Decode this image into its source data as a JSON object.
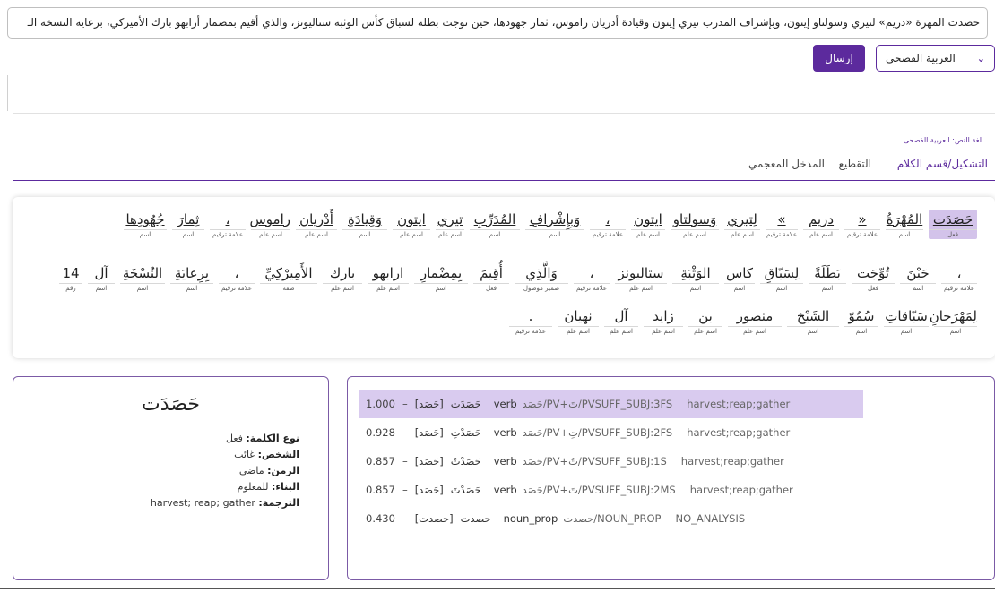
{
  "input_text": "حصدت المهرة «دريم» لتيري وسولتاو إيتون، وبإشراف المدرب تيري إيتون وقيادة أدريان راموس، ثمار جهودها، حين توجت بطلة لسباق كأس الوثبة ستاليونز، والذي أقيم بمضمار أرابهو بارك الأميركي، برعاية النسخة الـ",
  "dialect_select": {
    "value": "العربية الفصحى",
    "chevron": "⌄"
  },
  "submit_label": "إرسال",
  "lang_label": "لغة النص: العربية الفصحى",
  "tabs": [
    "التشكيل/قسم الكلام",
    "التقطيع",
    "المدخل المعجمي"
  ],
  "words": [
    {
      "w": "حَصَدَت",
      "t": "فعل"
    },
    {
      "w": "المُهْرَةُ",
      "t": "اسم"
    },
    {
      "w": "«",
      "t": "علامة ترقيم"
    },
    {
      "w": "دريم",
      "t": "اسم علم"
    },
    {
      "w": "»",
      "t": "علامة ترقيم"
    },
    {
      "w": "لِتيري",
      "t": "اسم علم"
    },
    {
      "w": "وَسولتاو",
      "t": "اسم علم"
    },
    {
      "w": "ايتون",
      "t": "اسم علم"
    },
    {
      "w": "،",
      "t": "علامة ترقيم"
    },
    {
      "w": "وَبِإِشْرافِ",
      "t": "اسم"
    },
    {
      "w": "المُدَرِّبِ",
      "t": "اسم"
    },
    {
      "w": "تيري",
      "t": "اسم علم"
    },
    {
      "w": "ايتون",
      "t": "اسم علم"
    },
    {
      "w": "وَقِيادَةِ",
      "t": "اسم"
    },
    {
      "w": "أَدْريان",
      "t": "اسم علم"
    },
    {
      "w": "راموس",
      "t": "اسم علم"
    },
    {
      "w": "،",
      "t": "علامة ترقيم"
    },
    {
      "w": "ثِمارَ",
      "t": "اسم"
    },
    {
      "w": "جُهُودِها",
      "t": "اسم"
    },
    {
      "w": "،",
      "t": "علامة ترقيم"
    },
    {
      "w": "حَيْنَ",
      "t": "اسم"
    },
    {
      "w": "تُوِّجَت",
      "t": "فعل"
    },
    {
      "w": "بَطَلَةً",
      "t": "اسم"
    },
    {
      "w": "لِسَبّاقِ",
      "t": "اسم"
    },
    {
      "w": "كاس",
      "t": "اسم"
    },
    {
      "w": "الوَثْبَةِ",
      "t": "اسم"
    },
    {
      "w": "ستاليونز",
      "t": "اسم علم"
    },
    {
      "w": "،",
      "t": "علامة ترقيم"
    },
    {
      "w": "وَالَّذِي",
      "t": "ضمير موصول"
    },
    {
      "w": "أُقِيمَ",
      "t": "فعل"
    },
    {
      "w": "بِمِضْمارِ",
      "t": "اسم"
    },
    {
      "w": "ارابهو",
      "t": "اسم علم"
    },
    {
      "w": "بارك",
      "t": "اسم علم"
    },
    {
      "w": "الأَمِيرْكِيِّ",
      "t": "صفة"
    },
    {
      "w": "،",
      "t": "علامة ترقيم"
    },
    {
      "w": "بِرِعايَةِ",
      "t": "اسم"
    },
    {
      "w": "النُسْخَةِ",
      "t": "اسم"
    },
    {
      "w": "آل",
      "t": "اسم"
    },
    {
      "w": "14",
      "t": "رقم"
    },
    {
      "w": "لِمَهْرَجانِ",
      "t": "اسم"
    },
    {
      "w": "سَبّاقاتِ",
      "t": "اسم"
    },
    {
      "w": "سُمُوّ",
      "t": "اسم"
    },
    {
      "w": "الشَيْخ",
      "t": "اسم"
    },
    {
      "w": "منصور",
      "t": "اسم علم"
    },
    {
      "w": "بن",
      "t": "اسم علم"
    },
    {
      "w": "زايد",
      "t": "اسم علم"
    },
    {
      "w": "آل",
      "t": "اسم علم"
    },
    {
      "w": "نهيان",
      "t": "اسم علم"
    },
    {
      "w": ".",
      "t": "علامة ترقيم"
    }
  ],
  "detail": {
    "title": "حَصَدَت",
    "rows": [
      {
        "k": "نوع الكلمة:",
        "v": "فعل"
      },
      {
        "k": "الشخص:",
        "v": "غائب"
      },
      {
        "k": "الزمن:",
        "v": "ماضي"
      },
      {
        "k": "البناء:",
        "v": "للمعلوم"
      },
      {
        "k": "الترجمة:",
        "v": "harvest; reap; gather"
      }
    ]
  },
  "analyses": [
    {
      "score": "1.000",
      "dash": "–",
      "diac": "حَصَدَت",
      "lex": "[حَصَد]",
      "pos": "verb",
      "bw": "حَصَد/PV+تَ/PVSUFF_SUBJ:3FS",
      "gloss": "harvest;reap;gather"
    },
    {
      "score": "0.928",
      "dash": "–",
      "diac": "حَصَدْتِ",
      "lex": "[حَصَد]",
      "pos": "verb",
      "bw": "حَصَد/PV+تِ/PVSUFF_SUBJ:2FS",
      "gloss": "harvest;reap;gather"
    },
    {
      "score": "0.857",
      "dash": "–",
      "diac": "حَصَدْتُ",
      "lex": "[حَصَد]",
      "pos": "verb",
      "bw": "حَصَد/PV+تُ/PVSUFF_SUBJ:1S",
      "gloss": "harvest;reap;gather"
    },
    {
      "score": "0.857",
      "dash": "–",
      "diac": "حَصَدْتَ",
      "lex": "[حَصَد]",
      "pos": "verb",
      "bw": "حَصَد/PV+تَ/PVSUFF_SUBJ:2MS",
      "gloss": "harvest;reap;gather"
    },
    {
      "score": "0.430",
      "dash": "–",
      "diac": "حصدت",
      "lex": "[حصدت]",
      "pos": "noun_prop",
      "bw": "حصدت/NOUN_PROP",
      "gloss": "NO_ANALYSIS"
    }
  ]
}
